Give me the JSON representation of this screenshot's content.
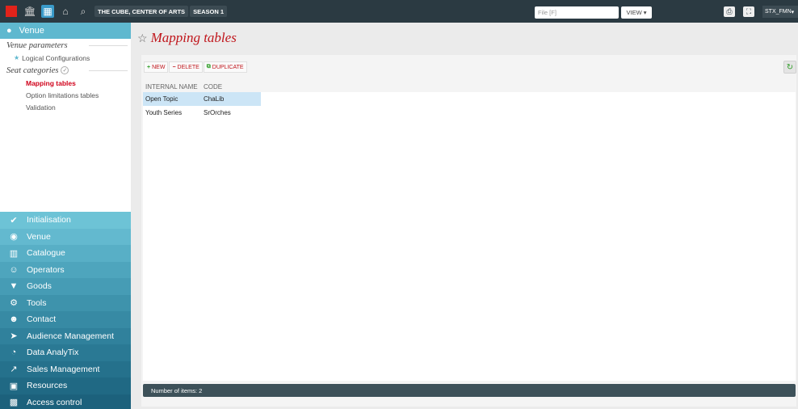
{
  "topbar": {
    "brand_color": "#e2231a",
    "icons": [
      "museum-icon",
      "building-icon",
      "home-icon",
      "search-icon"
    ],
    "chips": [
      "THE CUBE, CENTER OF ARTS",
      "SEASON 1"
    ],
    "file_placeholder": "File [F]",
    "view_label": "VIEW",
    "user_label": "STX_FMN"
  },
  "sidebar": {
    "venue_label": "Venue",
    "section1_title": "Venue parameters",
    "logical_configurations": "Logical Configurations",
    "section2_title": "Seat categories",
    "items": [
      {
        "label": "Mapping tables",
        "active": true
      },
      {
        "label": "Option limitations tables",
        "active": false
      },
      {
        "label": "Validation",
        "active": false
      }
    ],
    "modules": [
      {
        "label": "Initialisation",
        "icon": "check-icon",
        "color": "#6dc3d6"
      },
      {
        "label": "Venue",
        "icon": "pin-icon",
        "color": "#63b9cf"
      },
      {
        "label": "Catalogue",
        "icon": "book-icon",
        "color": "#58afc6"
      },
      {
        "label": "Operators",
        "icon": "person-icon",
        "color": "#4ea5bd"
      },
      {
        "label": "Goods",
        "icon": "tshirt-icon",
        "color": "#469cb5"
      },
      {
        "label": "Tools",
        "icon": "gear-icon",
        "color": "#3e93ac"
      },
      {
        "label": "Contact",
        "icon": "contacts-icon",
        "color": "#378aa4"
      },
      {
        "label": "Audience Management",
        "icon": "send-icon",
        "color": "#30819c"
      },
      {
        "label": "Data AnalyTix",
        "icon": "analytics-icon",
        "color": "#2a7994"
      },
      {
        "label": "Sales Management",
        "icon": "sales-chart-icon",
        "color": "#25718c"
      },
      {
        "label": "Resources",
        "icon": "calendar-icon",
        "color": "#206984"
      },
      {
        "label": "Access control",
        "icon": "scanner-icon",
        "color": "#1c617c"
      }
    ]
  },
  "main": {
    "title": "Mapping tables",
    "toolbar": {
      "new": "NEW",
      "delete": "DELETE",
      "duplicate": "DUPLICATE"
    },
    "columns": [
      "INTERNAL NAME",
      "CODE"
    ],
    "rows": [
      {
        "name": "Open Topic",
        "code": "ChaLib",
        "selected": true
      },
      {
        "name": "Youth Series",
        "code": "SrOrches",
        "selected": false
      }
    ],
    "footer": "Number of items: 2"
  }
}
